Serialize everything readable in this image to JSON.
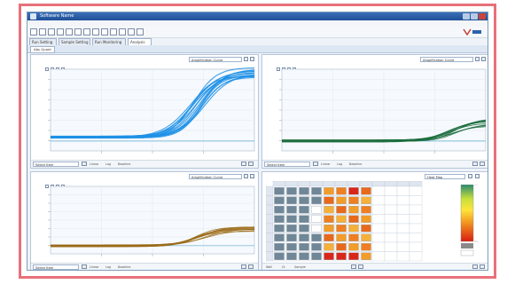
{
  "app": {
    "title": "Software Name"
  },
  "menu": [
    "File",
    "Setup",
    "Tools",
    "Sample",
    "Help"
  ],
  "tabs": [
    {
      "label": "Run Setting"
    },
    {
      "label": "Sample Setting"
    },
    {
      "label": "Run Monitoring"
    },
    {
      "label": "Analysis",
      "active": true
    }
  ],
  "subtab": "Abs Quant",
  "panels": [
    {
      "id": "top-left",
      "curve_type": "Amplification Curve",
      "color": "#1e90e6",
      "footer_select": "Select Item",
      "footer_opts": [
        "Linear",
        "Log",
        "Baseline"
      ]
    },
    {
      "id": "top-right",
      "curve_type": "Amplification Curve",
      "color": "#1a6b3c",
      "footer_select": "Select Item",
      "footer_opts": [
        "Linear",
        "Log",
        "Baseline"
      ]
    },
    {
      "id": "bottom-left",
      "curve_type": "Amplification Curve",
      "color": "#9a6a16",
      "footer_select": "Select Item",
      "footer_opts": [
        "Linear",
        "Log",
        "Baseline"
      ]
    }
  ],
  "plate": {
    "select": "Heat Map",
    "rows": 8,
    "cols": 12,
    "footer_opts": [
      "Well",
      "Ct",
      "Sample"
    ]
  },
  "colors": {
    "accent": "#2a63b0",
    "frame": "#e8707a"
  }
}
